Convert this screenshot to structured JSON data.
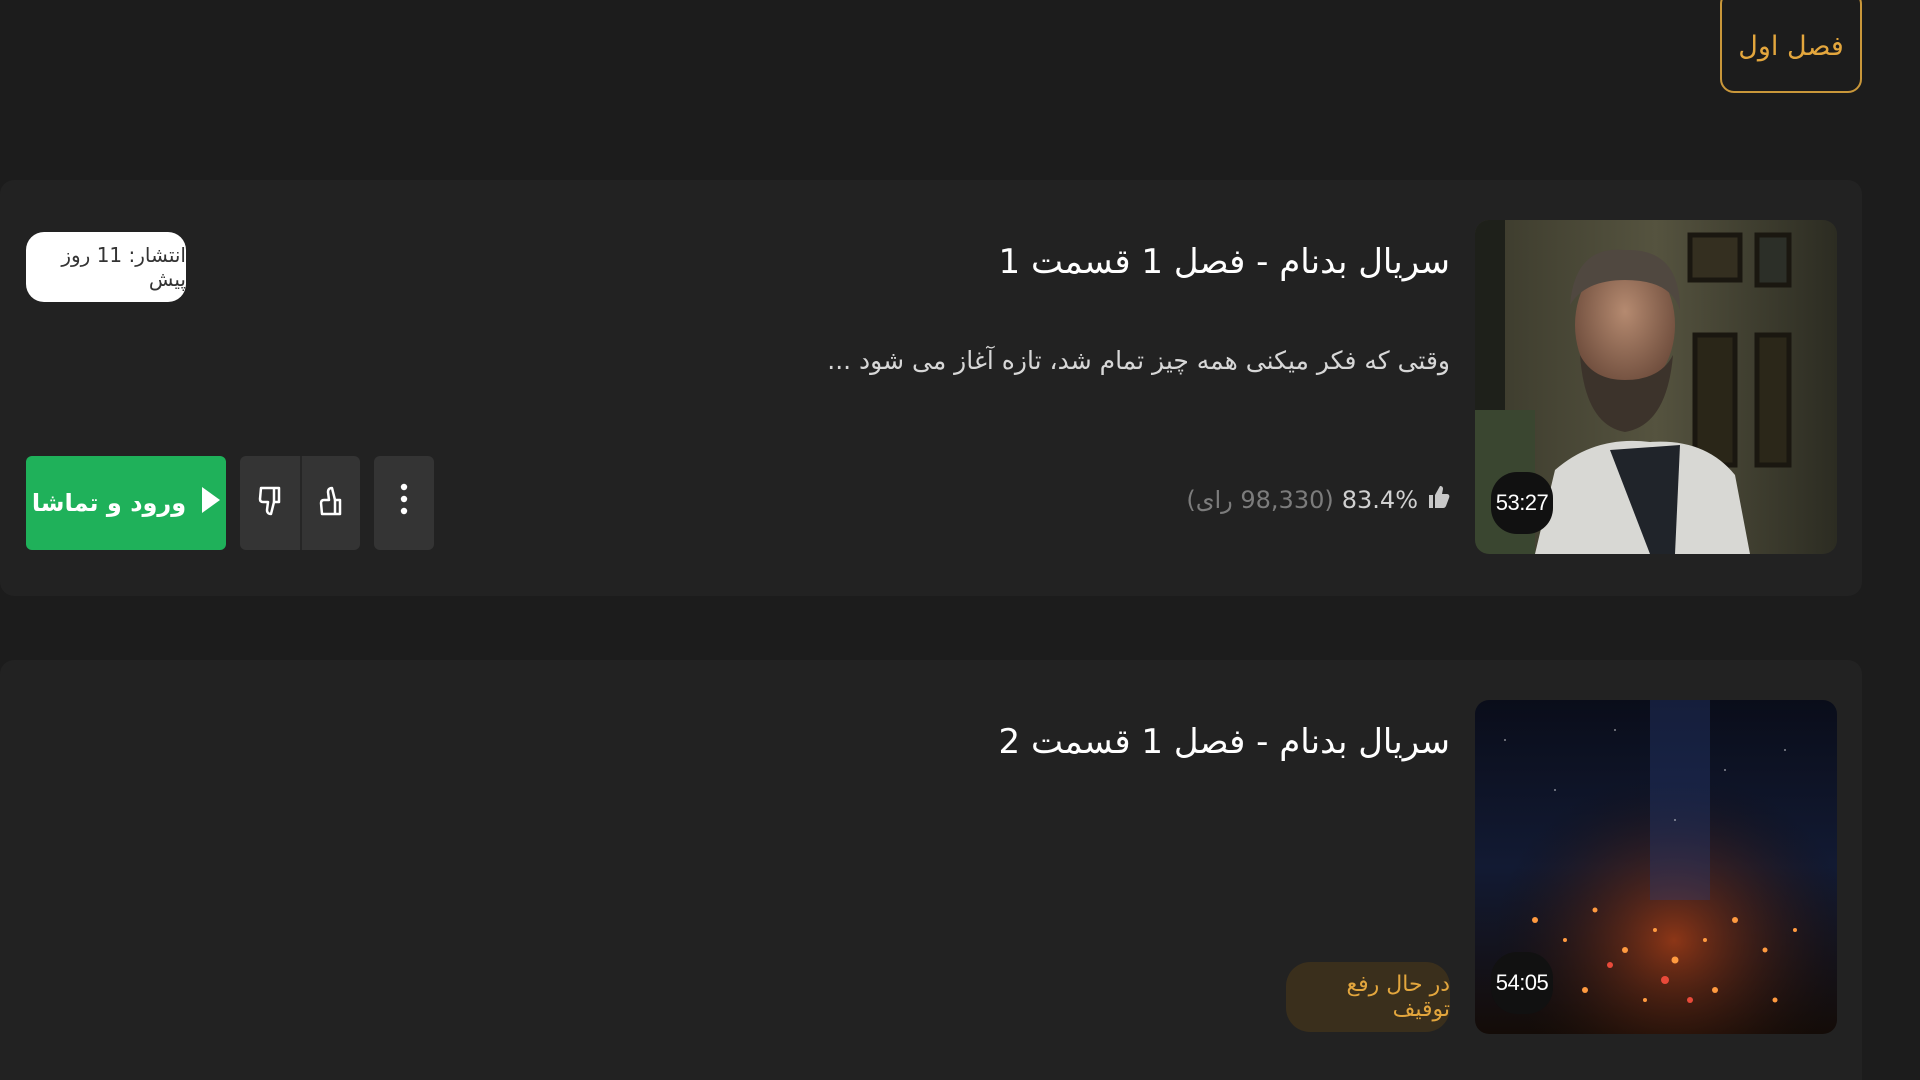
{
  "season_tab": {
    "label": "فصل اول"
  },
  "episodes": [
    {
      "title": "سریال بدنام - فصل 1 قسمت 1",
      "description": "وقتی که فکر میکنی همه چیز تمام شد، تازه آغاز می شود ...",
      "duration": "53:27",
      "rating_percent": "83.4%",
      "rating_votes": "(98,330 رای)",
      "publish_label": "انتشار: 11 روز پیش",
      "watch_label": "ورود و تماشا",
      "icons": [
        "thumbs-up-icon",
        "thumbs-down-icon",
        "more-vertical-icon",
        "play-icon"
      ]
    },
    {
      "title": "سریال بدنام - فصل 1 قسمت 2",
      "duration": "54:05",
      "status_label": "در حال رفع توقیف"
    }
  ],
  "colors": {
    "background": "#1c1c1c",
    "card": "#222222",
    "accent": "#e3a63d",
    "watch_button": "#1fb15a"
  }
}
